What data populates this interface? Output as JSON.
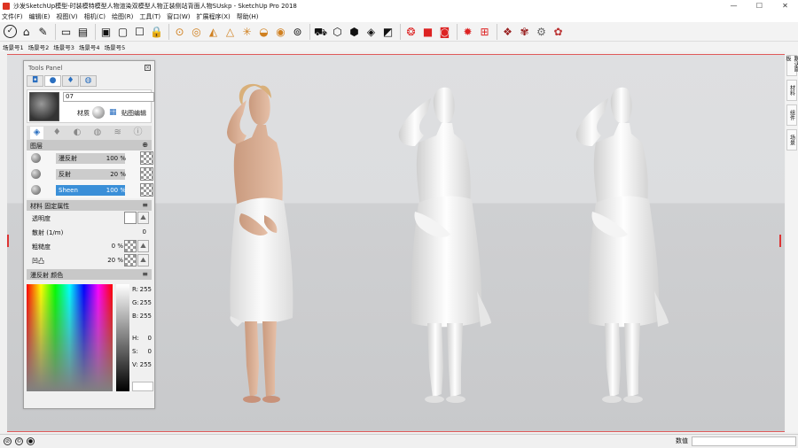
{
  "window": {
    "title": "沙发SketchUp模型-时装模特模型人物渲染双模型人物正装侧站背面人物SUskp - SketchUp Pro 2018",
    "minimize": "—",
    "maximize": "☐",
    "close": "✕"
  },
  "menu": [
    "文件(F)",
    "编辑(E)",
    "视图(V)",
    "相机(C)",
    "绘图(R)",
    "工具(T)",
    "窗口(W)",
    "扩展程序(X)",
    "帮助(H)"
  ],
  "toolbar_icons": [
    "select-icon",
    "eraser-icon",
    "paint-icon",
    "line-icon",
    "rectangle-icon",
    "circle-icon",
    "push-pull-icon",
    "move-icon",
    "rotate-icon",
    "scale-icon",
    "offset-icon",
    "tape-icon",
    "text-icon",
    "orbit-icon",
    "pan-icon",
    "zoom-icon",
    "zoom-extents-icon",
    "warehouse-icon",
    "extension-icon",
    "render-icon",
    "camera-icon",
    "settings-icon",
    "component-icon",
    "v-ray-icon",
    "v-ray-render-icon",
    "v-ray-light-icon",
    "v-ray-sphere-icon"
  ],
  "scenes": [
    "场景号1",
    "场景号2",
    "场景号3",
    "场景号4",
    "场景号5"
  ],
  "colors": {
    "accent": "#3a8fd8",
    "view_edge": "#e05a5a"
  },
  "tools_panel": {
    "title": "Tools Panel",
    "material_name": "07",
    "btn_label_1": "材质",
    "btn_label_2": "贴图编辑",
    "layers_header": "图层",
    "layers": [
      {
        "name": "漫反射",
        "value": "100 %"
      },
      {
        "name": "反射",
        "value": "20 %"
      },
      {
        "name": "Sheen",
        "value": "100 %"
      }
    ],
    "props_header": "材料 固定属性",
    "props": [
      {
        "label": "透明度",
        "value": ""
      },
      {
        "label": "散射 (1/m)",
        "value": "0"
      },
      {
        "label": "粗糙度",
        "value": "0 %"
      },
      {
        "label": "凹凸",
        "value": "20 %"
      }
    ],
    "color_header": "漫反射 颜色",
    "color": {
      "R": "255",
      "G": "255",
      "B": "255",
      "H": "0",
      "S": "0",
      "V": "255"
    }
  },
  "right_tabs": [
    "默认面板",
    "材料",
    "组件",
    "场景"
  ],
  "status": {
    "measure_label": "数值",
    "measure_value": ""
  }
}
